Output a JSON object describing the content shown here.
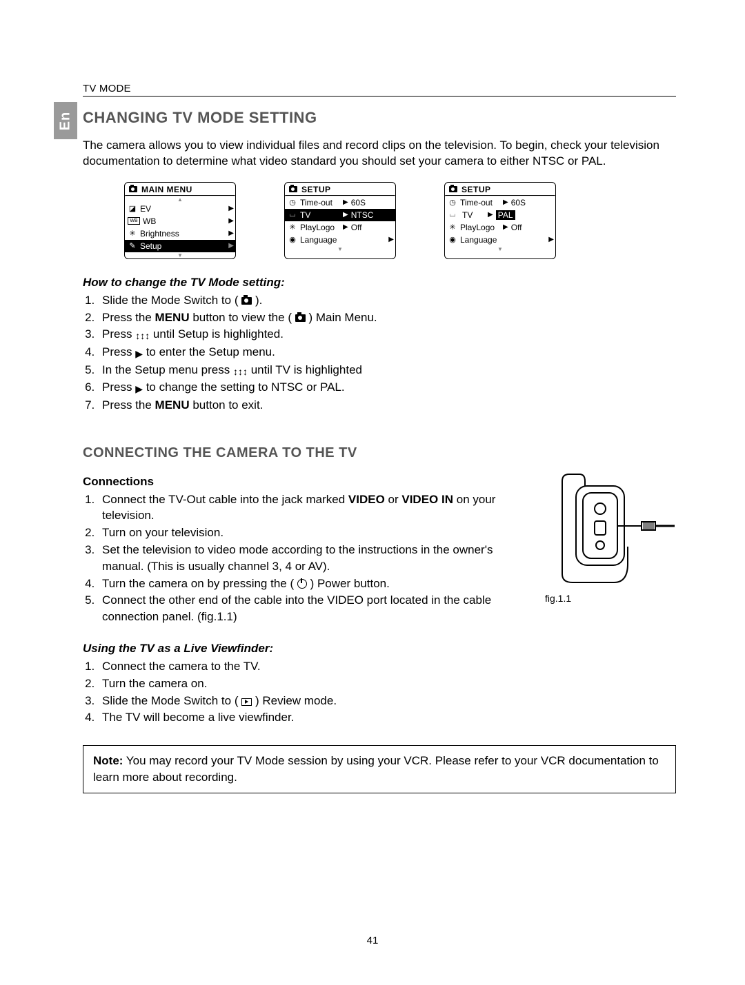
{
  "langTab": "En",
  "headerLine": "TV MODE",
  "title1": "CHANGING TV MODE SETTING",
  "intro": "The camera allows you to view individual files and record clips on the television. To begin, check your television documentation to determine what video standard you should set your camera to either NTSC or PAL.",
  "mainMenu": {
    "title": "MAIN MENU",
    "items": {
      "ev": "EV",
      "wb": "WB",
      "brightness": "Brightness",
      "setup": "Setup"
    }
  },
  "setupMenuA": {
    "title": "SETUP",
    "rows": {
      "timeout": {
        "label": "Time-out",
        "value": "60S"
      },
      "tv": {
        "label": "TV",
        "value": "NTSC"
      },
      "playlogo": {
        "label": "PlayLogo",
        "value": "Off"
      },
      "language": {
        "label": "Language",
        "value": ""
      }
    }
  },
  "setupMenuB": {
    "title": "SETUP",
    "rows": {
      "timeout": {
        "label": "Time-out",
        "value": "60S"
      },
      "tv": {
        "label": "TV",
        "value": "PAL"
      },
      "playlogo": {
        "label": "PlayLogo",
        "value": "Off"
      },
      "language": {
        "label": "Language",
        "value": ""
      }
    }
  },
  "howToChange": {
    "heading": "How to change the TV Mode setting:",
    "step1a": "Slide the Mode Switch to ( ",
    "step1b": " ).",
    "step2a": "Press the ",
    "step2b": "MENU",
    "step2c": " button to view the ( ",
    "step2d": " ) Main Menu.",
    "step3a": "Press ",
    "step3b": " until Setup is highlighted.",
    "step4a": "Press ",
    "step4b": " to enter the Setup menu.",
    "step5a": "In the Setup menu press ",
    "step5b": " until TV is highlighted",
    "step6a": "Press ",
    "step6b": " to change the setting to NTSC or PAL.",
    "step7a": "Press the ",
    "step7b": "MENU",
    "step7c": " button to exit."
  },
  "title2": "CONNECTING THE CAMERA TO THE TV",
  "connections": {
    "heading": "Connections",
    "s1a": "Connect the TV-Out cable into the jack marked ",
    "s1b": "VIDEO",
    "s1c": " or ",
    "s1d": "VIDEO IN",
    "s1e": " on your television.",
    "s2": "Turn on your television.",
    "s3": "Set the television to video mode according to the instructions in the owner's manual. (This is usually channel 3, 4 or AV).",
    "s4a": "Turn the camera on by pressing the ( ",
    "s4b": " ) Power button.",
    "s5": "Connect the other end of the cable into the VIDEO port located in the cable connection panel. (fig.1.1)"
  },
  "figCaption": "fig.1.1",
  "viewfinder": {
    "heading": "Using the TV as a Live Viewfinder:",
    "s1": "Connect the camera to the TV.",
    "s2": "Turn the camera on.",
    "s3a": "Slide the Mode Switch to ( ",
    "s3b": " ) Review mode.",
    "s4": "The TV will become a live viewfinder."
  },
  "note": {
    "label": "Note:",
    "text": " You may record your TV Mode session by using your VCR.  Please refer to your VCR documentation to learn more about recording."
  },
  "pageNumber": "41"
}
